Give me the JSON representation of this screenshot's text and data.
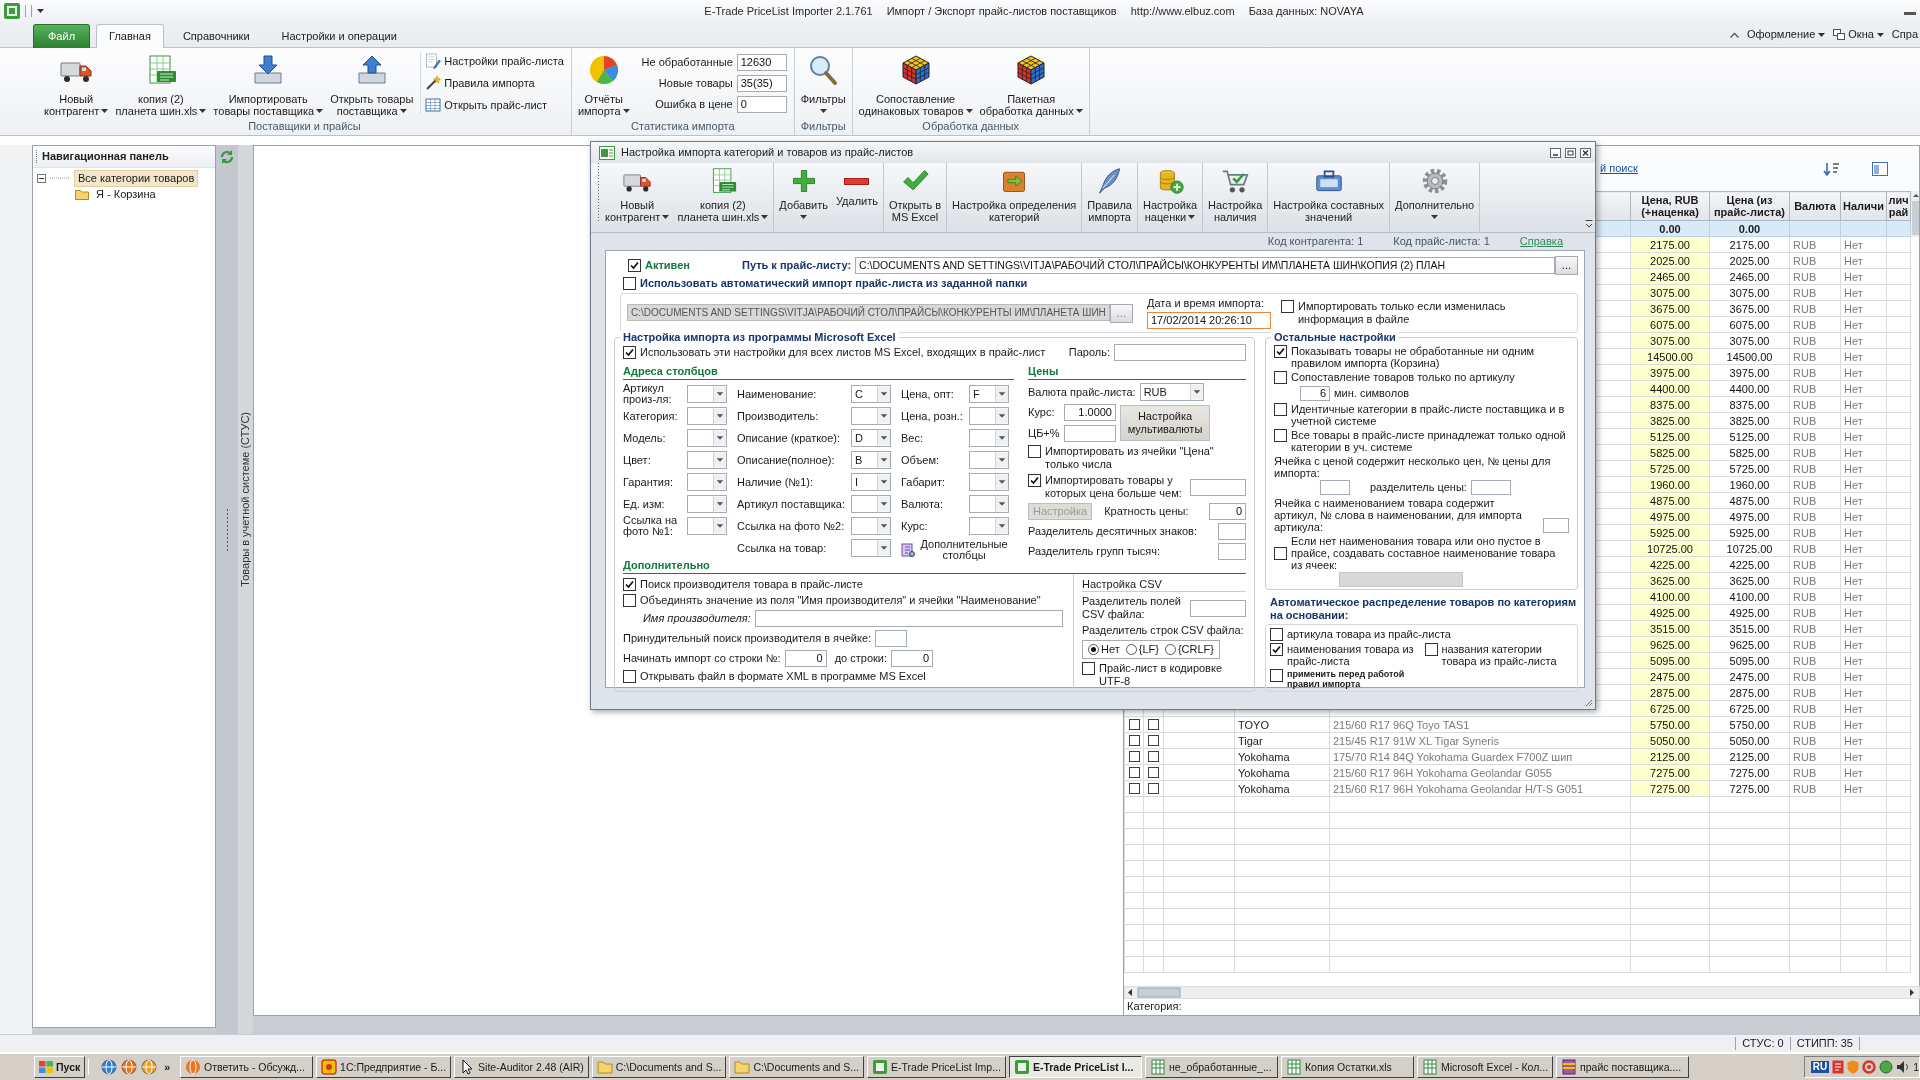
{
  "window": {
    "title": "E-Trade PriceList Importer 2.1.761",
    "subtitle": "Импорт / Экспорт прайс-листов поставщиков",
    "site": "http://www.elbuz.com",
    "database": "База данных: NOVAYA"
  },
  "menu_tabs": [
    {
      "label": "Файл",
      "kind": "file",
      "selected": false
    },
    {
      "label": "Главная",
      "kind": "tab",
      "selected": true
    },
    {
      "label": "Справочники",
      "kind": "tab",
      "selected": false
    },
    {
      "label": "Настройки и операции",
      "kind": "tab",
      "selected": false
    }
  ],
  "menu_right": [
    {
      "label": "Оформление",
      "dropdown": true
    },
    {
      "label": "Окна",
      "dropdown": true
    },
    {
      "label": "Спра",
      "dropdown": false
    }
  ],
  "ribbon": {
    "groups": [
      {
        "label": "Поставщики и прайсы",
        "buttons": [
          {
            "lines": [
              "Новый",
              "контрагент"
            ],
            "dropdown": true
          },
          {
            "lines": [
              "копия (2)",
              "планета шин.xls"
            ],
            "dropdown": true
          },
          {
            "lines": [
              "Импортировать",
              "товары поставщика"
            ],
            "dropdown": true
          },
          {
            "lines": [
              "Открыть товары",
              "поставщика"
            ],
            "dropdown": true
          }
        ],
        "small_buttons": [
          "Настройки прайс-листа",
          "Правила импорта",
          "Открыть прайс-лист"
        ]
      },
      {
        "label": "Статистика импорта",
        "buttons": [
          {
            "lines": [
              "Отчёты",
              "импорта"
            ],
            "dropdown": true
          }
        ],
        "stats": [
          {
            "label": "Не обработанные",
            "value": "12630"
          },
          {
            "label": "Новые товары",
            "value": "35(35)"
          },
          {
            "label": "Ошибка в цене",
            "value": "0"
          }
        ]
      },
      {
        "label": "Фильтры",
        "buttons": [
          {
            "lines": [
              "Фильтры"
            ],
            "dropdown": true
          }
        ]
      },
      {
        "label": "Обработка данных",
        "buttons": [
          {
            "lines": [
              "Сопоставление",
              "одинаковых товаров"
            ],
            "dropdown": true
          },
          {
            "lines": [
              "Пакетная",
              "обработка данных"
            ],
            "dropdown": true
          }
        ]
      }
    ]
  },
  "nav": {
    "title": "Навигационная панель",
    "tree": [
      {
        "label": "Все категории товаров",
        "selected": true,
        "expanded": true,
        "children": [
          {
            "label": "Я - Корзина",
            "selected": false
          }
        ]
      }
    ]
  },
  "side_tab": "Товары в учетной системе (СТУС)",
  "goods_table": {
    "search_link": "й поиск",
    "columns": [
      {
        "lines": [
          "Цена, RUB",
          "(+наценка)"
        ]
      },
      {
        "lines": [
          "Цена (из",
          "прайс-листа)"
        ]
      },
      {
        "lines": [
          "Валюта"
        ]
      },
      {
        "lines": [
          "Наличи"
        ]
      },
      {
        "lines": [
          "лич",
          "рай"
        ]
      }
    ],
    "filter": [
      "0.00",
      "0.00"
    ],
    "rows": [
      {
        "price": "2175.00",
        "list_price": "2175.00",
        "currency": "RUB",
        "stock": "Нет"
      },
      {
        "price": "2025.00",
        "list_price": "2025.00",
        "currency": "RUB",
        "stock": "Нет"
      },
      {
        "price": "2465.00",
        "list_price": "2465.00",
        "currency": "RUB",
        "stock": "Нет"
      },
      {
        "price": "3075.00",
        "list_price": "3075.00",
        "currency": "RUB",
        "stock": "Нет"
      },
      {
        "price": "3675.00",
        "list_price": "3675.00",
        "currency": "RUB",
        "stock": "Нет"
      },
      {
        "price": "6075.00",
        "list_price": "6075.00",
        "currency": "RUB",
        "stock": "Нет"
      },
      {
        "price": "3075.00",
        "list_price": "3075.00",
        "currency": "RUB",
        "stock": "Нет"
      },
      {
        "price": "14500.00",
        "list_price": "14500.00",
        "currency": "RUB",
        "stock": "Нет"
      },
      {
        "price": "3975.00",
        "list_price": "3975.00",
        "currency": "RUB",
        "stock": "Нет"
      },
      {
        "price": "4400.00",
        "list_price": "4400.00",
        "currency": "RUB",
        "stock": "Нет"
      },
      {
        "price": "8375.00",
        "list_price": "8375.00",
        "currency": "RUB",
        "stock": "Нет"
      },
      {
        "price": "3825.00",
        "list_price": "3825.00",
        "currency": "RUB",
        "stock": "Нет"
      },
      {
        "price": "5125.00",
        "list_price": "5125.00",
        "currency": "RUB",
        "stock": "Нет"
      },
      {
        "price": "5825.00",
        "list_price": "5825.00",
        "currency": "RUB",
        "stock": "Нет"
      },
      {
        "price": "5725.00",
        "list_price": "5725.00",
        "currency": "RUB",
        "stock": "Нет"
      },
      {
        "price": "1960.00",
        "list_price": "1960.00",
        "currency": "RUB",
        "stock": "Нет"
      },
      {
        "price": "4875.00",
        "list_price": "4875.00",
        "currency": "RUB",
        "stock": "Нет"
      },
      {
        "price": "4975.00",
        "list_price": "4975.00",
        "currency": "RUB",
        "stock": "Нет"
      },
      {
        "price": "5925.00",
        "list_price": "5925.00",
        "currency": "RUB",
        "stock": "Нет"
      },
      {
        "price": "10725.00",
        "list_price": "10725.00",
        "currency": "RUB",
        "stock": "Нет"
      },
      {
        "price": "4225.00",
        "list_price": "4225.00",
        "currency": "RUB",
        "stock": "Нет"
      },
      {
        "price": "3625.00",
        "list_price": "3625.00",
        "currency": "RUB",
        "stock": "Нет"
      },
      {
        "price": "4100.00",
        "list_price": "4100.00",
        "currency": "RUB",
        "stock": "Нет"
      },
      {
        "price": "4925.00",
        "list_price": "4925.00",
        "currency": "RUB",
        "stock": "Нет"
      },
      {
        "price": "3515.00",
        "list_price": "3515.00",
        "currency": "RUB",
        "stock": "Нет"
      },
      {
        "price": "9625.00",
        "list_price": "9625.00",
        "currency": "RUB",
        "stock": "Нет"
      },
      {
        "price": "5095.00",
        "list_price": "5095.00",
        "currency": "RUB",
        "stock": "Нет"
      },
      {
        "price": "2475.00",
        "list_price": "2475.00",
        "currency": "RUB",
        "stock": "Нет"
      },
      {
        "price": "2875.00",
        "list_price": "2875.00",
        "currency": "RUB",
        "stock": "Нет"
      },
      {
        "price": "6725.00",
        "list_price": "6725.00",
        "currency": "RUB",
        "stock": "Нет"
      },
      {
        "checkbox_1": false,
        "checkbox_2": false,
        "manufacturer": "TOYO",
        "description": "215/60 R17 96Q Toyo TAS1",
        "price": "5750.00",
        "list_price": "5750.00",
        "currency": "RUB",
        "stock": "Нет"
      },
      {
        "checkbox_1": false,
        "checkbox_2": false,
        "manufacturer": "Tigar",
        "description": "215/45 R17 91W XL Tigar Syneris",
        "price": "5050.00",
        "list_price": "5050.00",
        "currency": "RUB",
        "stock": "Нет"
      },
      {
        "checkbox_1": false,
        "checkbox_2": false,
        "manufacturer": "Yokohama",
        "description": "175/70 R14 84Q Yokohama Guardex F700Z шип",
        "price": "2125.00",
        "list_price": "2125.00",
        "currency": "RUB",
        "stock": "Нет"
      },
      {
        "checkbox_1": false,
        "checkbox_2": false,
        "manufacturer": "Yokohama",
        "description": "215/60 R17 96H Yokohama Geolandar G055",
        "price": "7275.00",
        "list_price": "7275.00",
        "currency": "RUB",
        "stock": "Нет"
      },
      {
        "checkbox_1": false,
        "checkbox_2": false,
        "manufacturer": "Yokohama",
        "description": "215/60 R17 96H Yokohama Geolandar H/T-S G051",
        "price": "7275.00",
        "list_price": "7275.00",
        "currency": "RUB",
        "stock": "Нет"
      }
    ],
    "category_label": "Категория:"
  },
  "status_bar": [
    "СТУС: 0",
    "СТИПП: 35"
  ],
  "taskbar": {
    "start": "Пуск",
    "more": "»",
    "tasks": [
      {
        "label": "Ответить - Обсужд...",
        "kind": "browser",
        "selected": false
      },
      {
        "label": "1С:Предприятие - Б...",
        "kind": "app",
        "selected": false
      },
      {
        "label": "Site-Auditor 2.48 (AIR)",
        "kind": "cursor",
        "selected": false
      },
      {
        "label": "C:\\Documents and S...",
        "kind": "folder",
        "selected": false
      },
      {
        "label": "C:\\Documents and S...",
        "kind": "folder",
        "selected": false
      },
      {
        "label": "E-Trade PriceList Imp...",
        "kind": "etrade",
        "selected": false
      },
      {
        "label": "E-Trade PriceList I...",
        "kind": "etrade",
        "selected": true
      },
      {
        "label": "не_обработанные_...",
        "kind": "sheet",
        "selected": false
      },
      {
        "label": "Копия Остатки.xls",
        "kind": "sheet",
        "selected": false
      },
      {
        "label": "Microsoft Excel - Кол...",
        "kind": "sheet",
        "selected": false
      },
      {
        "label": "прайс поставщика....",
        "kind": "archive",
        "selected": false
      }
    ],
    "language": "RU",
    "clock": "1"
  },
  "dialog": {
    "title": "Настройка импорта категорий и товаров из прайс-листов",
    "toolbar": [
      [
        {
          "lines": [
            "Новый",
            "контрагент"
          ],
          "dropdown": true
        },
        {
          "lines": [
            "копия (2)",
            "планета шин.xls"
          ],
          "dropdown": true
        }
      ],
      [
        {
          "lines": [
            "Добавить"
          ],
          "dropdown": true
        },
        {
          "lines": [
            "Удалить"
          ],
          "dropdown": false
        }
      ],
      [
        {
          "lines": [
            "Открыть в",
            "MS Excel"
          ],
          "dropdown": false
        }
      ],
      [
        {
          "lines": [
            "Настройка определения",
            "категорий"
          ],
          "dropdown": false
        }
      ],
      [
        {
          "lines": [
            "Правила",
            "импорта"
          ],
          "dropdown": false
        }
      ],
      [
        {
          "lines": [
            "Настройка",
            "наценки"
          ],
          "dropdown": true
        }
      ],
      [
        {
          "lines": [
            "Настройка",
            "наличия"
          ],
          "dropdown": false
        }
      ],
      [
        {
          "lines": [
            "Настройка составных",
            "значений"
          ],
          "dropdown": false
        }
      ],
      [
        {
          "lines": [
            "Дополнительно"
          ],
          "dropdown": true
        }
      ]
    ],
    "info": [
      "Код контрагента: 1",
      "Код прайс-листа: 1"
    ],
    "help_link": "Справка",
    "active": {
      "label": "Активен",
      "checked": true
    },
    "path": {
      "label": "Путь к прайс-листу:",
      "value": "C:\\DOCUMENTS AND SETTINGS\\VITJA\\РАБОЧИЙ СТОЛ\\ПРАЙСЫ\\КОНКУРЕНТЫ ИМ\\ПЛАНЕТА ШИН\\КОПИЯ (2) ПЛАН",
      "button": "..."
    },
    "auto_import": {
      "label": "Использовать автоматический импорт прайс-листа из заданной папки",
      "checked": false,
      "folder": {
        "value": "C:\\DOCUMENTS AND SETTINGS\\VITJA\\РАБОЧИЙ СТОЛ\\ПРАЙСЫ\\КОНКУРЕНТЫ ИМ\\ПЛАНЕТА ШИН",
        "button": "...",
        "disabled": true
      },
      "date": {
        "label": "Дата и время импорта:",
        "value": "17/02/2014 20:26:10"
      },
      "only_changed": {
        "label": "Импортировать только если изменилась информация в файле",
        "checked": false
      }
    },
    "excel": {
      "title": "Настройка импорта из программы Microsoft Excel",
      "all_sheets": {
        "label": "Использовать эти настройки для всех листов MS Excel, входящих в прайс-лист",
        "checked": true
      },
      "password_label": "Пароль:",
      "columns_title": "Адреса столбцов",
      "columns": [
        [
          {
            "label": "Артикул произ-ля:"
          },
          {
            "label": "Категория:"
          },
          {
            "label": "Модель:"
          },
          {
            "label": "Цвет:"
          },
          {
            "label": "Гарантия:"
          },
          {
            "label": "Ед. изм:"
          },
          {
            "label": "Ссылка на фото №1:"
          }
        ],
        [
          {
            "label": "Наименование:",
            "value": "C"
          },
          {
            "label": "Производитель:"
          },
          {
            "label": "Описание (краткое):",
            "value": "D"
          },
          {
            "label": "Описание(полное):",
            "value": "B"
          },
          {
            "label": "Наличие (№1):",
            "value": "I"
          },
          {
            "label": "Артикул поставщика:"
          },
          {
            "label": "Ссылка на фото №2:"
          },
          {
            "label": "Ссылка на товар:"
          }
        ],
        [
          {
            "label": "Цена, опт:",
            "value": "F"
          },
          {
            "label": "Цена, розн.:"
          },
          {
            "label": "Вес:"
          },
          {
            "label": "Объем:"
          },
          {
            "label": "Габарит:"
          },
          {
            "label": "Валюта:"
          },
          {
            "label": "Курс:"
          }
        ]
      ],
      "extra_columns_button": "Дополнительные столбцы",
      "prices": {
        "title": "Цены",
        "currency": {
          "label": "Валюта прайс-листа:",
          "value": "RUB"
        },
        "rate": {
          "label": "Курс:",
          "value": "1.0000"
        },
        "cb_label": "ЦБ+%",
        "multicurrency_button": "Настройка мультивалюты",
        "numbers_only": {
          "label": "Импортировать из ячейки \"Цена\" только числа",
          "checked": false
        },
        "min_price": {
          "label": "Импортировать товары у которых цена больше чем:",
          "checked": true
        },
        "settings_button": {
          "label": "Настройка",
          "disabled": true
        },
        "multiplicity": {
          "label": "Кратность цены:",
          "value": "0"
        },
        "decimal_separator_label": "Разделитель десятичных знаков:",
        "thousands_separator_label": "Разделитель групп тысяч:"
      },
      "extra": {
        "title": "Дополнительно",
        "find_manufacturer": {
          "label": "Поиск производителя товара в прайс-листе",
          "checked": true
        },
        "merge": {
          "label": "Объединять значение из поля \"Имя производителя\" и ячейки \"Наименование\"",
          "checked": false
        },
        "manufacturer_name_label": "Имя производителя:",
        "forced_search_label": "Принудительный поиск производителя в ячейке:",
        "start_row": {
          "label": "Начинать импорт со строки №:",
          "value": "0"
        },
        "end_row": {
          "label": "до строки:",
          "value": "0"
        },
        "open_xml": {
          "label": "Открывать файл в формате XML в программе MS Excel",
          "checked": false
        }
      },
      "csv": {
        "title": "Настройка CSV",
        "field_separator_label": "Разделитель полей CSV файла:",
        "row_separator_label": "Разделитель строк CSV файла:",
        "row_separator": [
          {
            "label": "Нет",
            "selected": true
          },
          {
            "label": "{LF}",
            "selected": false
          },
          {
            "label": "{CRLF}",
            "selected": false
          }
        ],
        "utf8": {
          "label": "Прайс-лист в кодировке UTF-8",
          "checked": false
        }
      }
    },
    "other": {
      "title": "Остальные настройки",
      "items": [
        {
          "kind": "check",
          "label": "Показывать товары не обработанные ни одним правилом импорта (Корзина)",
          "checked": true
        },
        {
          "kind": "check",
          "label": "Сопоставление товаров только по артикулу",
          "checked": false,
          "min_length": {
            "value": "6",
            "label": "мин. символов"
          }
        },
        {
          "kind": "check",
          "label": "Идентичные категории в прайс-листе поставщика и в учетной системе",
          "checked": false
        },
        {
          "kind": "check",
          "label": "Все товары в прайс-листе принадлежат только одной категории в уч. системе",
          "checked": false
        },
        {
          "kind": "price_cell",
          "label": "Ячейка с ценой содержит несколько цен, № цены для импорта:",
          "separator_label": "разделитель цены:"
        },
        {
          "kind": "word_field",
          "label": "Ячейка с наименованием товара содержит артикул, № слова в наименовании, для импорта артикула:"
        },
        {
          "kind": "check_field",
          "label": "Если нет наименования товара или оно пустое в прайсе, создавать составное наименование товара из ячеек:",
          "checked": false
        }
      ]
    },
    "auto_category": {
      "title": "Автоматическое распределение товаров по категориям на основании:",
      "items": [
        {
          "kind": "wide",
          "label": "артикула товара из прайс-листа",
          "checked": false
        },
        {
          "kind": "half",
          "label": "наименования товара из прайс-листа",
          "checked": true
        },
        {
          "kind": "half",
          "label": "названия  категории товара из прайс-листа",
          "checked": false
        },
        {
          "kind": "small",
          "label": "применить перед работой правил импорта",
          "checked": false
        }
      ]
    }
  }
}
